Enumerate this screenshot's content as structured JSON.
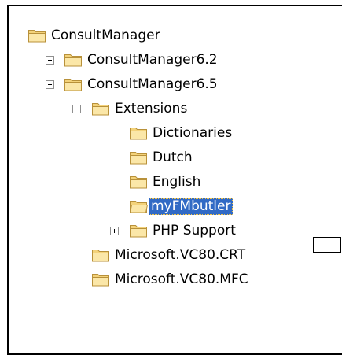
{
  "tree": {
    "items": [
      {
        "label": "ConsultManager",
        "expander": "none",
        "selected": false
      },
      {
        "label": "ConsultManager6.2",
        "expander": "plus",
        "selected": false
      },
      {
        "label": "ConsultManager6.5",
        "expander": "minus",
        "selected": false
      },
      {
        "label": "Extensions",
        "expander": "minus",
        "selected": false
      },
      {
        "label": "Dictionaries",
        "expander": "none",
        "selected": false
      },
      {
        "label": "Dutch",
        "expander": "none",
        "selected": false
      },
      {
        "label": "English",
        "expander": "none",
        "selected": false
      },
      {
        "label": "myFMbutler",
        "expander": "none",
        "selected": true
      },
      {
        "label": "PHP Support",
        "expander": "plus",
        "selected": false
      },
      {
        "label": "Microsoft.VC80.CRT",
        "expander": "none",
        "selected": false
      },
      {
        "label": "Microsoft.VC80.MFC",
        "expander": "none",
        "selected": false
      }
    ]
  },
  "colors": {
    "selection": "#316ac5",
    "folder": "#f3d27a"
  },
  "icons": {
    "folder": "folder-icon",
    "expand": "plus-box-icon",
    "collapse": "minus-box-icon"
  }
}
